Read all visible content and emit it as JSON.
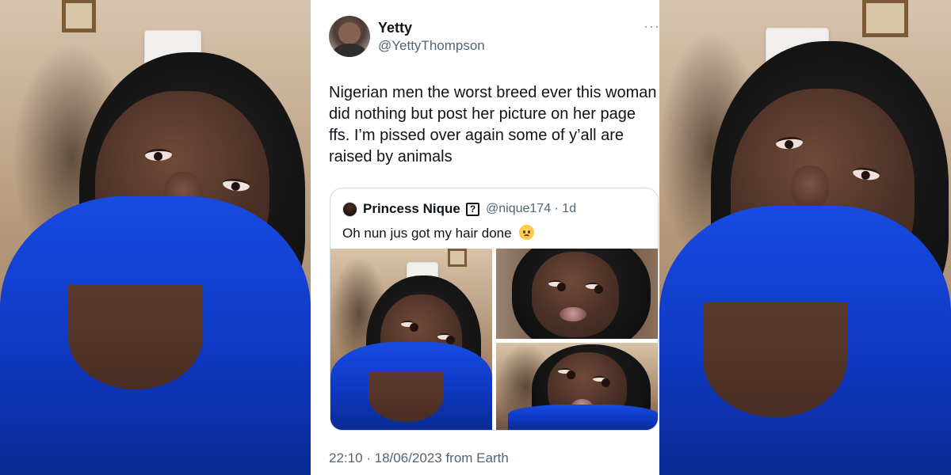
{
  "tweet": {
    "author": {
      "display_name": "Yetty",
      "handle": "@YettyThompson"
    },
    "menu_label": "···",
    "text": "Nigerian men the worst breed ever this woman\ndid nothing but post her picture on her page\nffs. I’m pissed over again some of y’all are\nraised by animals",
    "timestamp": "22:10 · 18/06/2023 from Earth"
  },
  "quote": {
    "author_name": "Princess Nique",
    "badge": "?",
    "meta": "@nique174 · 1d",
    "text": "Oh nun jus got my hair done",
    "emoji": "pleading-face-icon"
  },
  "colors": {
    "tweet_bg": "#ffffff",
    "text": "#0f1419",
    "secondary_text": "#536471",
    "border": "#cfd9de",
    "shirt": "#174be2"
  }
}
